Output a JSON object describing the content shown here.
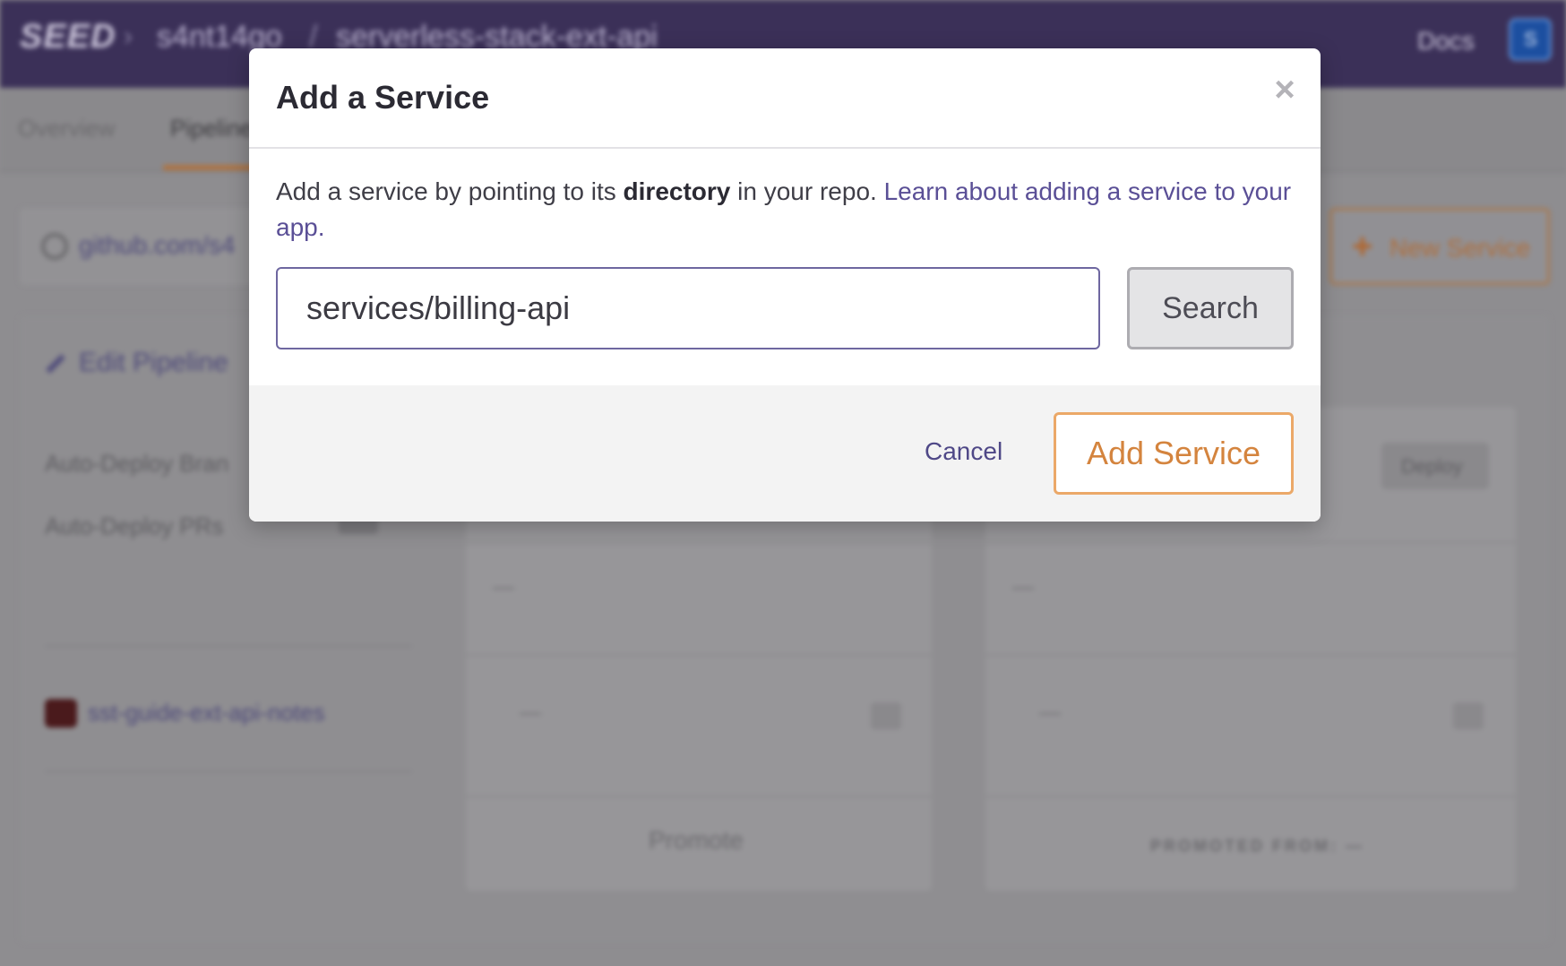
{
  "background": {
    "topbar": {
      "logo": "SEED",
      "separator": "›",
      "org": "s4nt14go",
      "slash": "/",
      "app_name": "serverless-stack-ext-api",
      "docs_label": "Docs",
      "avatar_initial": "S"
    },
    "tabs": [
      {
        "label": "Overview"
      },
      {
        "label": "Pipeline"
      }
    ],
    "repo_link": "github.com/s4",
    "new_service_label": "New Service",
    "edit_pipeline_label": "Edit Pipeline",
    "settings": [
      {
        "label": "Auto-Deploy Bran"
      },
      {
        "label": "Auto-Deploy PRs"
      }
    ],
    "service_name": "sst-guide-ext-api-notes",
    "placeholder_dash": "—",
    "deploy_label": "Deploy",
    "promote_label": "Promote",
    "promoted_from_label": "PROMOTED FROM: —"
  },
  "modal": {
    "title": "Add a Service",
    "close_glyph": "×",
    "desc_prefix": "Add a service by pointing to its ",
    "desc_bold": "directory",
    "desc_middle": " in your repo. ",
    "desc_link": "Learn about adding a service to your app.",
    "input_value": "services/billing-api",
    "search_label": "Search",
    "cancel_label": "Cancel",
    "add_label": "Add Service"
  },
  "colors": {
    "topbar": "#3b3058",
    "accent_orange": "#eba868",
    "link_purple": "#5a4f96",
    "overlay_gray": "#8e8d90"
  }
}
